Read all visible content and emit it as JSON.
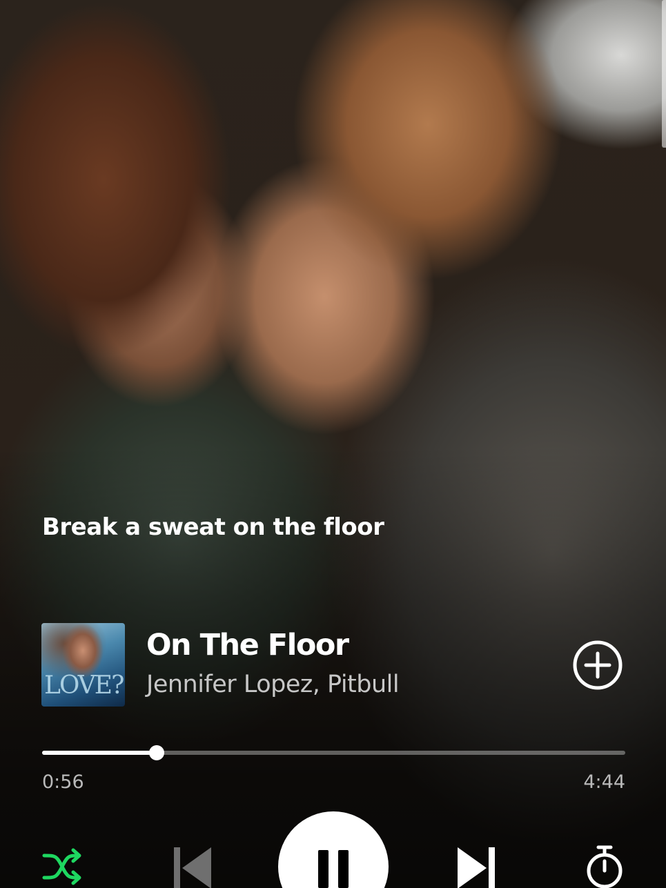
{
  "lyrics": {
    "current_line": "Break a sweat on the floor"
  },
  "track": {
    "title": "On The Floor",
    "artist": "Jennifer Lopez, Pitbull",
    "album_art_text": "LOVE?"
  },
  "playback": {
    "elapsed": "0:56",
    "total": "4:44",
    "progress_fraction": 0.197,
    "state": "playing",
    "shuffle_enabled": true
  },
  "icons": {
    "add": "plus-circle-icon",
    "shuffle": "shuffle-icon",
    "previous": "skip-previous-icon",
    "pause": "pause-icon",
    "next": "skip-next-icon",
    "timer": "sleep-timer-icon"
  },
  "colors": {
    "accent": "#1ed760",
    "text_primary": "#ffffff",
    "text_secondary": "#c7c7c7",
    "icon_disabled": "#6f6f6f"
  }
}
